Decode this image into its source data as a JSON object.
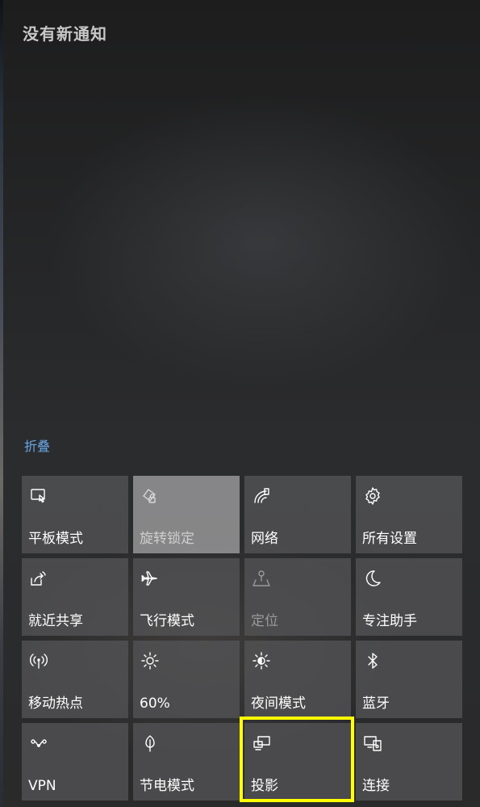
{
  "header": {
    "title": "没有新通知"
  },
  "collapse_label": "折叠",
  "tiles": [
    {
      "label": "平板模式",
      "icon": "tablet-mode-icon",
      "state": "normal"
    },
    {
      "label": "旋转锁定",
      "icon": "rotation-lock-icon",
      "state": "light"
    },
    {
      "label": "网络",
      "icon": "network-icon",
      "state": "normal"
    },
    {
      "label": "所有设置",
      "icon": "gear-icon",
      "state": "normal"
    },
    {
      "label": "就近共享",
      "icon": "nearby-share-icon",
      "state": "normal"
    },
    {
      "label": "飞行模式",
      "icon": "airplane-icon",
      "state": "normal"
    },
    {
      "label": "定位",
      "icon": "location-icon",
      "state": "dim"
    },
    {
      "label": "专注助手",
      "icon": "moon-icon",
      "state": "normal"
    },
    {
      "label": "移动热点",
      "icon": "hotspot-icon",
      "state": "normal"
    },
    {
      "label": "60%",
      "icon": "brightness-icon",
      "state": "normal"
    },
    {
      "label": "夜间模式",
      "icon": "night-light-icon",
      "state": "normal"
    },
    {
      "label": "蓝牙",
      "icon": "bluetooth-icon",
      "state": "normal"
    },
    {
      "label": "VPN",
      "icon": "vpn-icon",
      "state": "normal"
    },
    {
      "label": "节电模式",
      "icon": "battery-saver-icon",
      "state": "normal"
    },
    {
      "label": "投影",
      "icon": "project-icon",
      "state": "normal"
    },
    {
      "label": "连接",
      "icon": "connect-icon",
      "state": "normal"
    }
  ],
  "colors": {
    "highlight": "#ffff00",
    "link": "#6aa8e8"
  }
}
